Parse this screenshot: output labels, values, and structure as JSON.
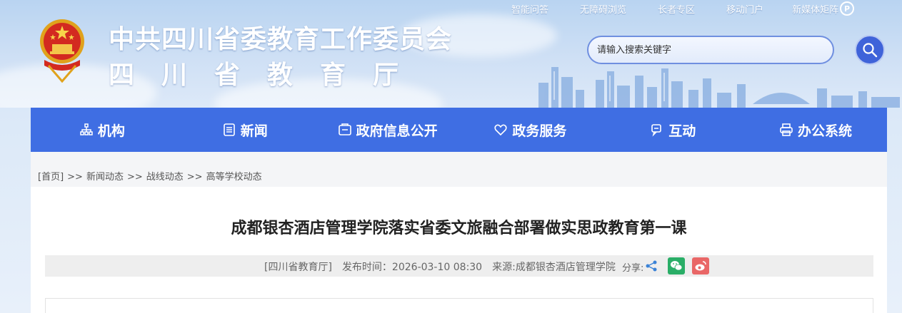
{
  "header": {
    "title_main": "中共四川省委教育工作委员会",
    "title_sub": "四川省教育厅",
    "top_links": [
      "智能问答",
      "无障碍浏览",
      "长者专区",
      "移动门户",
      "新媒体矩阵"
    ],
    "search": {
      "placeholder": "请输入搜索关键字"
    }
  },
  "nav": {
    "items": [
      {
        "label": "机构",
        "icon": "org-chart-icon"
      },
      {
        "label": "新闻",
        "icon": "news-icon"
      },
      {
        "label": "政府信息公开",
        "icon": "info-disclosure-icon"
      },
      {
        "label": "政务服务",
        "icon": "service-icon"
      },
      {
        "label": "互动",
        "icon": "chat-icon"
      },
      {
        "label": "办公系统",
        "icon": "printer-icon"
      }
    ]
  },
  "breadcrumb": {
    "items": [
      "[首页]",
      "新闻动态",
      "战线动态",
      "高等学校动态"
    ],
    "separator": ">>"
  },
  "article": {
    "title": "成都银杏酒店管理学院落实省委文旅融合部署做实思政教育第一课",
    "publisher": "[四川省教育厅]",
    "publish_time": "发布时间：2026-03-10 08:30",
    "source": "来源:成都银杏酒店管理学院",
    "share_label": "分享:"
  },
  "colors": {
    "nav_bg": "#3f6ee3",
    "wechat": "#2aae67",
    "weibo": "#e96767"
  }
}
